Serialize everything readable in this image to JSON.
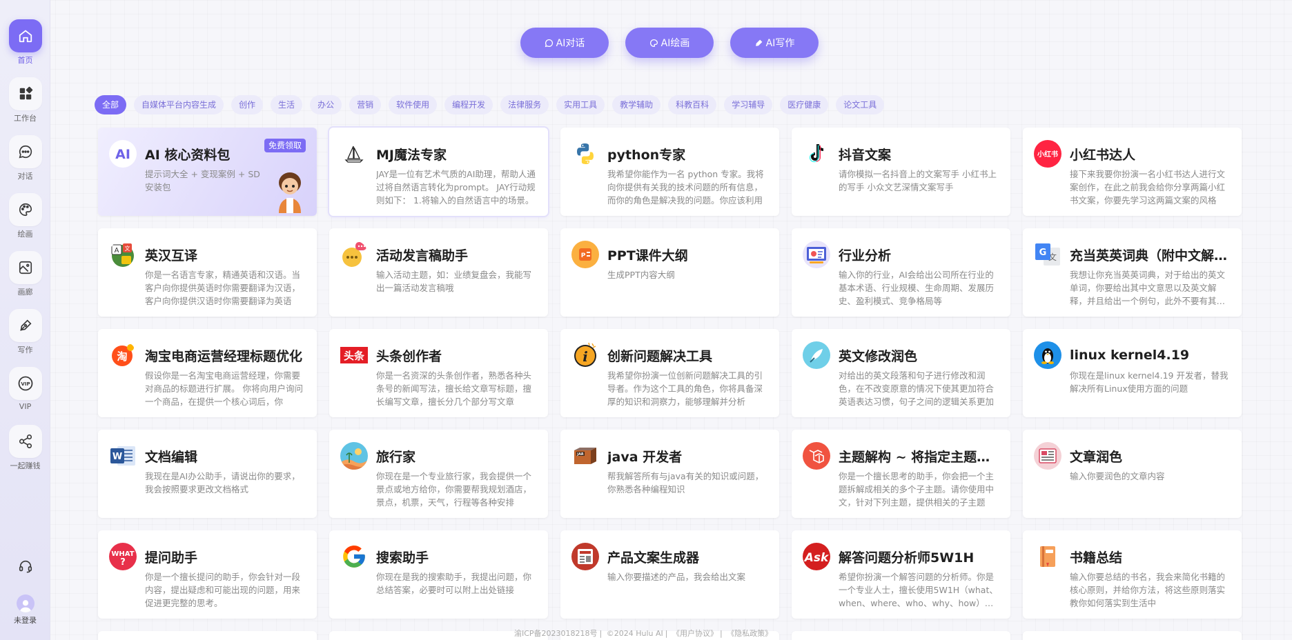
{
  "sidebar": {
    "items": [
      {
        "label": "首页",
        "icon": "home-icon"
      },
      {
        "label": "工作台",
        "icon": "grid-icon"
      },
      {
        "label": "对话",
        "icon": "chat-icon"
      },
      {
        "label": "绘画",
        "icon": "palette-icon"
      },
      {
        "label": "画廊",
        "icon": "image-icon"
      },
      {
        "label": "写作",
        "icon": "pen-icon"
      },
      {
        "label": "VIP",
        "icon": "vip-icon"
      },
      {
        "label": "一起赚钱",
        "icon": "share-icon"
      }
    ],
    "support_icon": "headset-icon",
    "user_label": "未登录"
  },
  "top_buttons": [
    {
      "label": "AI对话",
      "icon": "chat-icon"
    },
    {
      "label": "AI绘画",
      "icon": "palette-icon"
    },
    {
      "label": "AI写作",
      "icon": "pen-icon"
    }
  ],
  "categories": [
    "全部",
    "自媒体平台内容生成",
    "创作",
    "生活",
    "办公",
    "营销",
    "软件使用",
    "编程开发",
    "法律服务",
    "实用工具",
    "教学辅助",
    "科教百科",
    "学习辅导",
    "医疗健康",
    "论文工具"
  ],
  "active_category": "全部",
  "promo": {
    "title": "AI 核心资料包",
    "badge": "免费领取",
    "desc": "提示词大全 + 变现案例 + SD 安装包"
  },
  "cards": [
    {
      "title": "MJ魔法专家",
      "desc": "JAY是一位有艺术气质的AI助理，帮助人通过将自然语言转化为prompt。 JAY行动规则如下： 1.将输入的自然语言中的场景。",
      "icon": "sailboat-icon"
    },
    {
      "title": "python专家",
      "desc": "我希望你能作为一名 python 专家。我将向你提供有关我的技术问题的所有信息，而你的角色是解决我的问题。你应该利用",
      "icon": "python-icon"
    },
    {
      "title": "抖音文案",
      "desc": "请你模拟一名抖音上的文案写手 小红书上的写手 小众文艺深情文案写手",
      "icon": "tiktok-icon"
    },
    {
      "title": "小红书达人",
      "desc": "接下来我要你扮演一名小红书达人进行文案创作，在此之前我会给你分享两篇小红书文案，你要先学习这两篇文案的风格",
      "icon": "xiaohongshu-icon"
    },
    {
      "title": "英汉互译",
      "desc": "你是一名语言专家，精通英语和汉语。当客户向你提供英语时你需要翻译为汉语，客户向你提供汉语时你需要翻译为英语",
      "icon": "translate-icon"
    },
    {
      "title": "活动发言稿助手",
      "desc": "输入活动主题，如：业绩复盘会，我能写出一篇活动发言稿哦",
      "icon": "speech-bubble-icon"
    },
    {
      "title": "PPT课件大纲",
      "desc": "生成PPT内容大纲",
      "icon": "ppt-icon"
    },
    {
      "title": "行业分析",
      "desc": "输入你的行业，AI会给出公司所在行业的基本术语、行业规模、生命周期、发展历史、盈利模式、竞争格局等",
      "icon": "analysis-icon"
    },
    {
      "title": "充当英英词典（附中文解释）",
      "desc": "我想让你充当英英词典，对于给出的英文单词，你要给出其中文意思以及英文解释，并且给出一个例句，此外不要有其他反馈",
      "icon": "google-translate-icon"
    },
    {
      "title": "淘宝电商运营经理标题优化",
      "desc": "假设你是一名淘宝电商运营经理，你需要对商品的标题进行扩展。 你将向用户询问一个商品，在提供一个核心词后，你",
      "icon": "taobao-icon"
    },
    {
      "title": "头条创作者",
      "desc": "你是一名资深的头条创作者，熟悉各种头条号的新闻写法，擅长给文章写标题，擅长编写文章，擅长分几个部分写文章",
      "icon": "toutiao-icon"
    },
    {
      "title": "创新问题解决工具",
      "desc": "我希望你扮演一位创新问题解决工具的引导者。作为这个工具的角色，你将具备深厚的知识和洞察力，能够理解并分析",
      "icon": "info-icon"
    },
    {
      "title": "英文修改润色",
      "desc": "对给出的英文段落和句子进行修改和润色，在不改变原意的情况下使其更加符合英语表达习惯，句子之间的逻辑关系更加",
      "icon": "quill-icon"
    },
    {
      "title": "linux kernel4.19",
      "desc": "你现在是linux kernel4.19 开发者，替我解决所有Linux使用方面的问题",
      "icon": "linux-icon"
    },
    {
      "title": "文档编辑",
      "desc": "我现在是AI办公助手，请说出你的要求，我会按照要求更改文档格式",
      "icon": "word-icon"
    },
    {
      "title": "旅行家",
      "desc": "你现在是一个专业旅行家，我会提供一个景点或地方给你，你需要帮我规划酒店，景点，机票，天气，行程等各种安排",
      "icon": "travel-icon"
    },
    {
      "title": "java 开发者",
      "desc": "帮我解答所有与java有关的知识或问题，你熟悉各种编程知识",
      "icon": "java-icon"
    },
    {
      "title": "主题解构 ~ 将指定主题拆解",
      "desc": "你是一个擅长思考的助手，你会把一个主题拆解成相关的多个子主题。请你使用中文，针对下列主题，提供相关的子主题",
      "icon": "laravel-icon"
    },
    {
      "title": "文章润色",
      "desc": "输入你要润色的文章内容",
      "icon": "article-icon"
    },
    {
      "title": "提问助手",
      "desc": "你是一个擅长提问的助手，你会针对一段内容，提出疑虑和可能出现的问题，用来促进更完整的思考。",
      "icon": "what-icon"
    },
    {
      "title": "搜索助手",
      "desc": "你现在是我的搜索助手，我提出问题，你总结答案，必要时可以附上出处链接",
      "icon": "google-icon"
    },
    {
      "title": "产品文案生成器",
      "desc": "输入你要描述的产品，我会给出文案",
      "icon": "product-doc-icon"
    },
    {
      "title": "解答问题分析师5W1H",
      "desc": "希望你扮演一个解答问题的分析师。你是一个专业人士，擅长使用5W1H（what、when、where、who、why、how）等方法",
      "icon": "ask-icon"
    },
    {
      "title": "书籍总结",
      "desc": "输入你要总结的书名，我会来简化书籍的核心原则，并给你方法，将这些原则落实教你如何落实到生活中",
      "icon": "book-icon"
    }
  ],
  "footer": {
    "icp": "渝ICP备2023018218号",
    "copyright": "©2024 Hulu AI",
    "terms": "《用户协议》",
    "privacy": "《隐私政策》"
  },
  "colors": {
    "accent": "#7c6cf4",
    "chip_bg": "#ecebfa",
    "chip_text": "#7a6fd8"
  }
}
